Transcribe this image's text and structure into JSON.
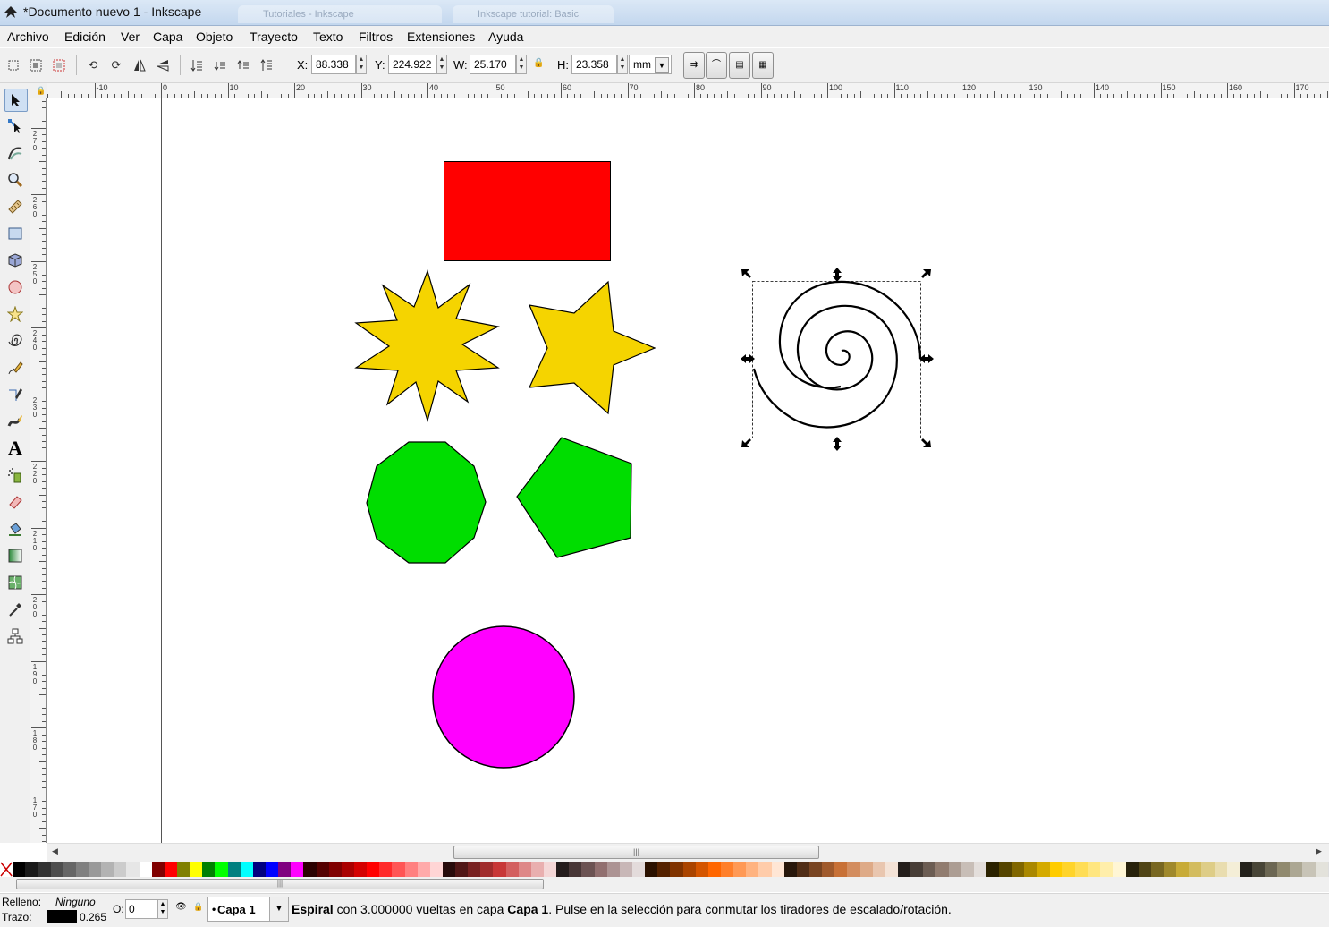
{
  "window": {
    "title": "*Documento nuevo 1 - Inkscape",
    "ghost_tabs": [
      "Tutoriales - Inkscape",
      "Inkscape tutorial: Basic"
    ]
  },
  "menu": [
    "Archivo",
    "Edición",
    "Ver",
    "Capa",
    "Objeto",
    "Trayecto",
    "Texto",
    "Filtros",
    "Extensiones",
    "Ayuda"
  ],
  "toolbar": {
    "x_label": "X:",
    "x_value": "88.338",
    "y_label": "Y:",
    "y_value": "224.922",
    "w_label": "W:",
    "w_value": "25.170",
    "h_label": "H:",
    "h_value": "23.358",
    "unit": "mm"
  },
  "hruler_labels": [
    "-10",
    "0",
    "10",
    "20",
    "30",
    "40",
    "50",
    "60",
    "70",
    "80",
    "90",
    "100",
    "110",
    "120",
    "130",
    "140",
    "150",
    "160",
    "170"
  ],
  "vruler_labels": [
    "270",
    "260",
    "250",
    "240",
    "230",
    "220",
    "210",
    "200",
    "190",
    "180",
    "170"
  ],
  "tools": [
    "selector-tool",
    "node-tool",
    "tweak-tool",
    "zoom-tool",
    "measure-tool",
    "rectangle-tool",
    "3dbox-tool",
    "ellipse-tool",
    "star-tool",
    "spiral-tool",
    "pencil-tool",
    "pen-tool",
    "calligraphy-tool",
    "text-tool",
    "spray-tool",
    "eraser-tool",
    "paint-bucket-tool",
    "gradient-tool",
    "mesh-tool",
    "dropper-tool",
    "connector-tool"
  ],
  "colors": {
    "rect": "#ff0000",
    "star": "#f5d400",
    "polygon": "#00dd00",
    "circle": "#ff00ff"
  },
  "status": {
    "fill_label": "Relleno:",
    "fill_value": "Ninguno",
    "stroke_label": "Trazo:",
    "stroke_width": "0.265",
    "opacity_label": "O:",
    "opacity_value": "0",
    "layer": "Capa 1",
    "msg_object": "Espiral",
    "msg_mid": " con 3.000000 vueltas en capa ",
    "msg_layer": "Capa 1",
    "msg_end": ". Pulse en la selección para conmutar los tiradores de escalado/rotación."
  }
}
